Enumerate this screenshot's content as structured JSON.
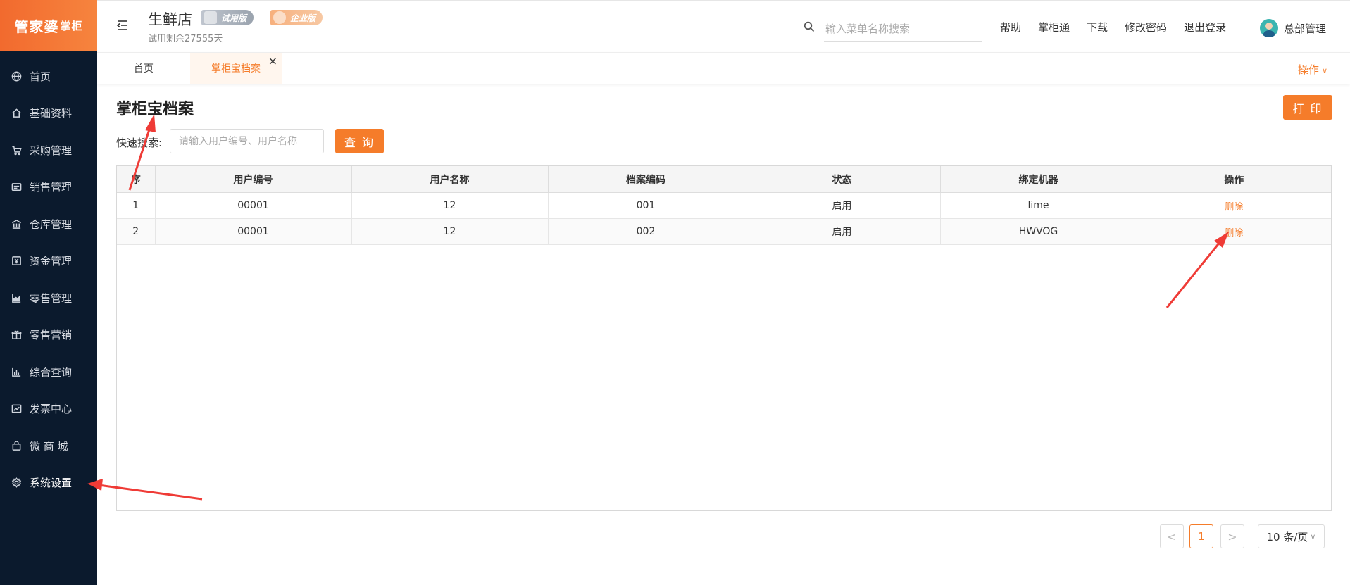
{
  "logo": {
    "main": "管家婆",
    "sub": "掌柜"
  },
  "sidebar": {
    "items": [
      {
        "label": "首页",
        "icon": "globe-icon"
      },
      {
        "label": "基础资料",
        "icon": "home-icon"
      },
      {
        "label": "采购管理",
        "icon": "cart-icon"
      },
      {
        "label": "销售管理",
        "icon": "sales-icon"
      },
      {
        "label": "仓库管理",
        "icon": "warehouse-icon"
      },
      {
        "label": "资金管理",
        "icon": "money-icon"
      },
      {
        "label": "零售管理",
        "icon": "retail-chart-icon"
      },
      {
        "label": "零售营销",
        "icon": "gift-icon"
      },
      {
        "label": "综合查询",
        "icon": "bar-chart-icon"
      },
      {
        "label": "发票中心",
        "icon": "invoice-chart-icon"
      },
      {
        "label": "微 商 城",
        "icon": "bag-icon"
      },
      {
        "label": "系统设置",
        "icon": "gear-icon"
      }
    ]
  },
  "header": {
    "shop_name": "生鲜店",
    "trial_badge": "试用版",
    "enterprise_badge": "企业版",
    "trial_remaining": "试用剩余27555天",
    "search_placeholder": "输入菜单名称搜索",
    "links": [
      "帮助",
      "掌柜通",
      "下载",
      "修改密码",
      "退出登录"
    ],
    "user_name": "总部管理"
  },
  "tabs": {
    "home": "首页",
    "active": "掌柜宝档案",
    "close": "×",
    "ops_label": "操作",
    "ops_chevron": "∨"
  },
  "page": {
    "title": "掌柜宝档案",
    "print_label": "打 印",
    "quick_search_label": "快速搜索:",
    "quick_search_placeholder": "请输入用户编号、用户名称",
    "query_label": "查 询"
  },
  "table": {
    "headers": [
      "序",
      "用户编号",
      "用户名称",
      "档案编码",
      "状态",
      "绑定机器",
      "操作"
    ],
    "rows": [
      {
        "index": "1",
        "user_code": "00001",
        "user_name": "12",
        "archive_code": "001",
        "status": "启用",
        "machine": "lime",
        "action": "删除"
      },
      {
        "index": "2",
        "user_code": "00001",
        "user_name": "12",
        "archive_code": "002",
        "status": "启用",
        "machine": "HWVOG",
        "action": "删除"
      }
    ]
  },
  "pagination": {
    "prev": "<",
    "current": "1",
    "next": ">",
    "page_size": "10 条/页",
    "page_size_chevron": "∨"
  },
  "colors": {
    "accent": "#f57c2a",
    "sidebar_bg": "#0b1a2d",
    "annotation_arrow": "#ef3b36"
  }
}
